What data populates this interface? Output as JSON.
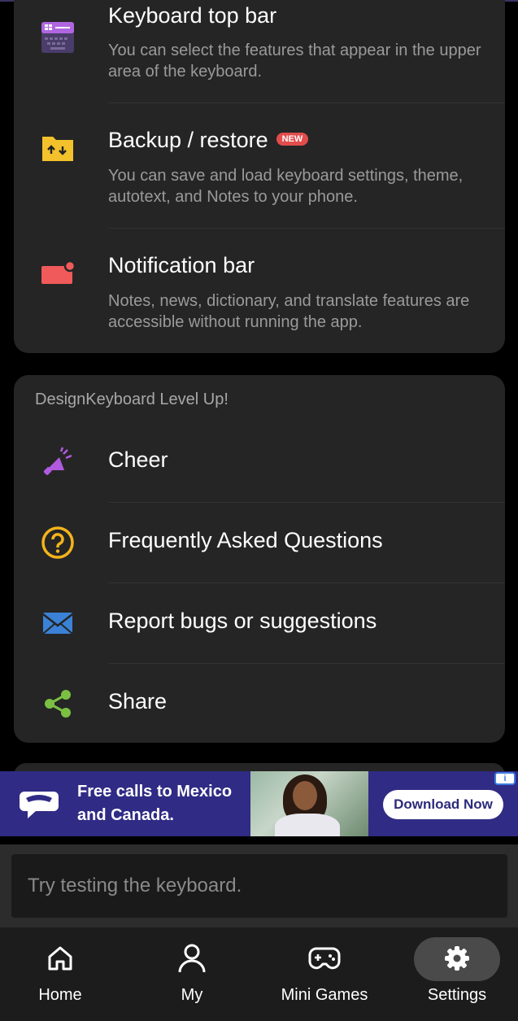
{
  "features": [
    {
      "icon": "keyboard-top-bar-icon",
      "title": "Keyboard top bar",
      "badge": "",
      "description": "You can select the features that appear in the upper area of the keyboard."
    },
    {
      "icon": "backup-folder-icon",
      "title": "Backup / restore",
      "badge": "NEW",
      "description": "You can save and load keyboard settings, theme, autotext, and Notes to your phone."
    },
    {
      "icon": "notification-bar-icon",
      "title": "Notification bar",
      "badge": "",
      "description": "Notes, news, dictionary, and translate features are accessible without running the app."
    }
  ],
  "level_up": {
    "section_title": "DesignKeyboard Level Up!",
    "items": [
      {
        "icon": "cheer-megaphone-icon",
        "label": "Cheer"
      },
      {
        "icon": "question-circle-icon",
        "label": "Frequently Asked Questions"
      },
      {
        "icon": "envelope-icon",
        "label": "Report bugs or suggestions"
      },
      {
        "icon": "share-icon",
        "label": "Share"
      }
    ]
  },
  "ad": {
    "text_line1": "Free calls to Mexico",
    "text_line2": "and Canada.",
    "button": "Download Now",
    "info_mark": "i"
  },
  "test_input": {
    "placeholder": "Try testing the keyboard.",
    "value": ""
  },
  "bottom_nav": [
    {
      "icon": "home-icon",
      "label": "Home",
      "active": false
    },
    {
      "icon": "person-icon",
      "label": "My",
      "active": false
    },
    {
      "icon": "gamepad-icon",
      "label": "Mini Games",
      "active": false
    },
    {
      "icon": "gear-icon",
      "label": "Settings",
      "active": true
    }
  ],
  "colors": {
    "background": "#000000",
    "card": "#252525",
    "secondary_text": "#9a9a9a",
    "ad_background": "#302b85",
    "badge_red": "#e24c4c",
    "nav_active_pill": "#4a4a4a"
  }
}
